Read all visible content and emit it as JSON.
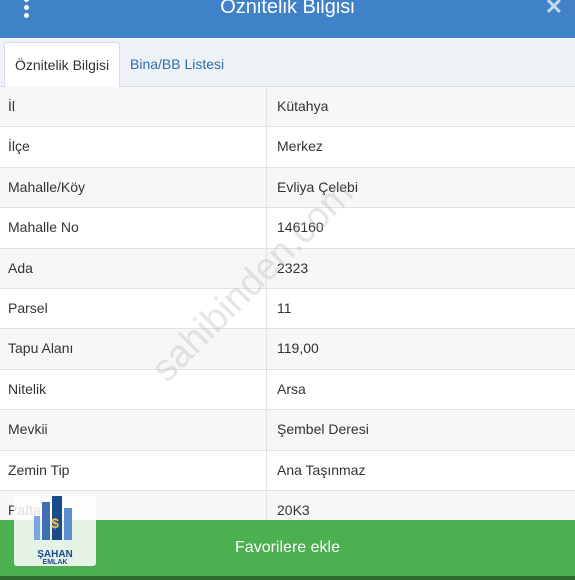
{
  "header": {
    "title": "Öznitelik Bilgisi"
  },
  "tabs": [
    {
      "label": "Öznitelik Bilgisi"
    },
    {
      "label": "Bina/BB Listesi"
    }
  ],
  "rows": [
    {
      "key": "İl",
      "value": "Kütahya"
    },
    {
      "key": "İlçe",
      "value": "Merkez"
    },
    {
      "key": "Mahalle/Köy",
      "value": "Evliya Çelebi"
    },
    {
      "key": "Mahalle No",
      "value": "146160"
    },
    {
      "key": "Ada",
      "value": "2323"
    },
    {
      "key": "Parsel",
      "value": "11"
    },
    {
      "key": "Tapu Alanı",
      "value": "119,00"
    },
    {
      "key": "Nitelik",
      "value": "Arsa"
    },
    {
      "key": "Mevkii",
      "value": "Şembel Deresi"
    },
    {
      "key": "Zemin Tip",
      "value": "Ana Taşınmaz"
    },
    {
      "key": "Pafta",
      "value": "20K3"
    }
  ],
  "watermark": "sahibinden.com",
  "footer": {
    "favorite_label": "Favorilere ekle"
  },
  "logo": {
    "name": "ŞAHAN",
    "sub": "EMLAK"
  },
  "colors": {
    "header": "#3f82c8",
    "favorite": "#4caf50"
  }
}
